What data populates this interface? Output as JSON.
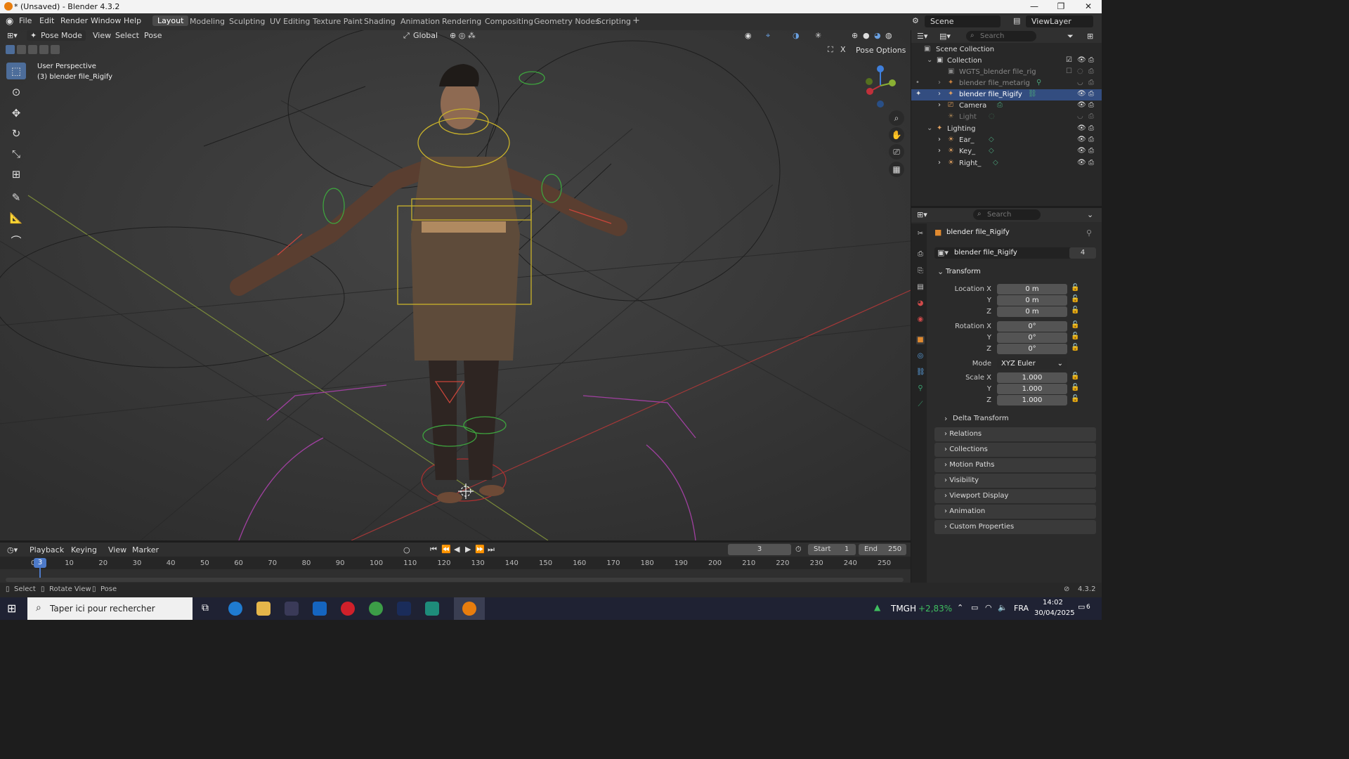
{
  "window": {
    "title": "* (Unsaved) - Blender 4.3.2",
    "min": "—",
    "max": "❐",
    "close": "✕"
  },
  "menu": [
    "File",
    "Edit",
    "Render",
    "Window",
    "Help"
  ],
  "workspaces": [
    "Layout",
    "Modeling",
    "Sculpting",
    "UV Editing",
    "Texture Paint",
    "Shading",
    "Animation",
    "Rendering",
    "Compositing",
    "Geometry Nodes",
    "Scripting"
  ],
  "workspace_add": "+",
  "scene": {
    "name": "Scene",
    "view_layer": "ViewLayer"
  },
  "viewport": {
    "mode": "Pose Mode",
    "menus": [
      "View",
      "Select",
      "Pose"
    ],
    "orientation": "Global",
    "pose_options": "Pose Options",
    "overlay_line1": "User Perspective",
    "overlay_line2": "(3) blender file_Rigify"
  },
  "outliner": {
    "search_placeholder": "Search",
    "rows": [
      {
        "label": "Scene Collection"
      },
      {
        "label": "Collection"
      },
      {
        "label": "WGTS_blender file_rig"
      },
      {
        "label": "blender file_metarig"
      },
      {
        "label": "blender file_Rigify"
      },
      {
        "label": "Camera"
      },
      {
        "label": "Light"
      },
      {
        "label": "Lighting"
      },
      {
        "label": "Ear_"
      },
      {
        "label": "Key_"
      },
      {
        "label": "Right_"
      }
    ]
  },
  "properties": {
    "search_placeholder": "Search",
    "object_name": "blender file_Rigify",
    "datablock": "blender file_Rigify",
    "users": "4",
    "transform_label": "Transform",
    "location": {
      "label": "Location X",
      "x": "0 m",
      "y": "0 m",
      "z": "0 m"
    },
    "rotation": {
      "label": "Rotation X",
      "x": "0°",
      "y": "0°",
      "z": "0°"
    },
    "mode_label": "Mode",
    "mode_value": "XYZ Euler",
    "scale": {
      "label": "Scale X",
      "x": "1.000",
      "y": "1.000",
      "z": "1.000"
    },
    "axis_y": "Y",
    "axis_z": "Z",
    "delta": "Delta Transform",
    "sections": [
      "Relations",
      "Collections",
      "Motion Paths",
      "Visibility",
      "Viewport Display",
      "Animation",
      "Custom Properties"
    ]
  },
  "timeline": {
    "menus": [
      "Playback",
      "Keying",
      "View",
      "Marker"
    ],
    "current_frame": "3",
    "start_label": "Start",
    "start": "1",
    "end_label": "End",
    "end": "250",
    "ticks": [
      "0",
      "10",
      "20",
      "30",
      "40",
      "50",
      "60",
      "70",
      "80",
      "90",
      "100",
      "110",
      "120",
      "130",
      "140",
      "150",
      "160",
      "170",
      "180",
      "190",
      "200",
      "210",
      "220",
      "230",
      "240",
      "250"
    ]
  },
  "statusbar": {
    "select": "Select",
    "rotate": "Rotate View",
    "pose": "Pose",
    "version": "4.3.2"
  },
  "taskbar": {
    "search_placeholder": "Taper ici pour rechercher",
    "stock_name": "TMGH",
    "stock_change": "+2,83%",
    "lang": "FRA",
    "time": "14:02",
    "date": "30/04/2025",
    "notif_count": "6"
  },
  "colors": {
    "accent": "#4d6d9a",
    "selection": "#334d80",
    "stock_up": "#3fbf5f"
  }
}
